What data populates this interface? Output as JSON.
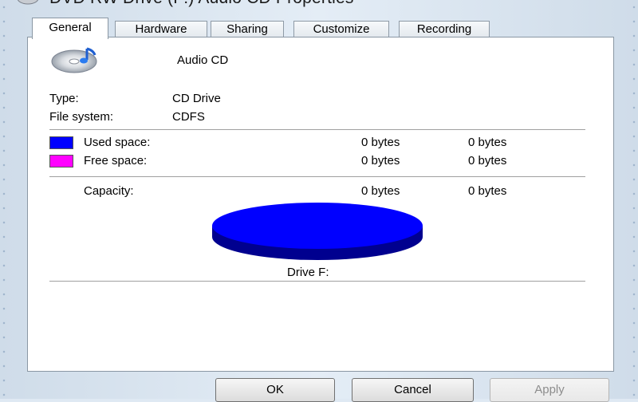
{
  "window": {
    "title": "DVD RW Drive (F:) Audio CD Properties"
  },
  "tabs": [
    {
      "label": "General",
      "active": true
    },
    {
      "label": "Hardware",
      "active": false
    },
    {
      "label": "Sharing",
      "active": false
    },
    {
      "label": "Customize",
      "active": false
    },
    {
      "label": "Recording",
      "active": false
    }
  ],
  "general": {
    "disc_label": "Audio CD",
    "type_label": "Type:",
    "type_value": "CD Drive",
    "fs_label": "File system:",
    "fs_value": "CDFS",
    "used_label": "Used space:",
    "used_bytes": "0 bytes",
    "used_size": "0 bytes",
    "free_label": "Free space:",
    "free_bytes": "0 bytes",
    "free_size": "0 bytes",
    "capacity_label": "Capacity:",
    "capacity_bytes": "0 bytes",
    "capacity_size": "0 bytes",
    "drive_label": "Drive F:"
  },
  "colors": {
    "used": "#0000ff",
    "free": "#ff00ff",
    "pie_edge": "#00008f"
  },
  "buttons": {
    "ok": "OK",
    "cancel": "Cancel",
    "apply": "Apply"
  }
}
